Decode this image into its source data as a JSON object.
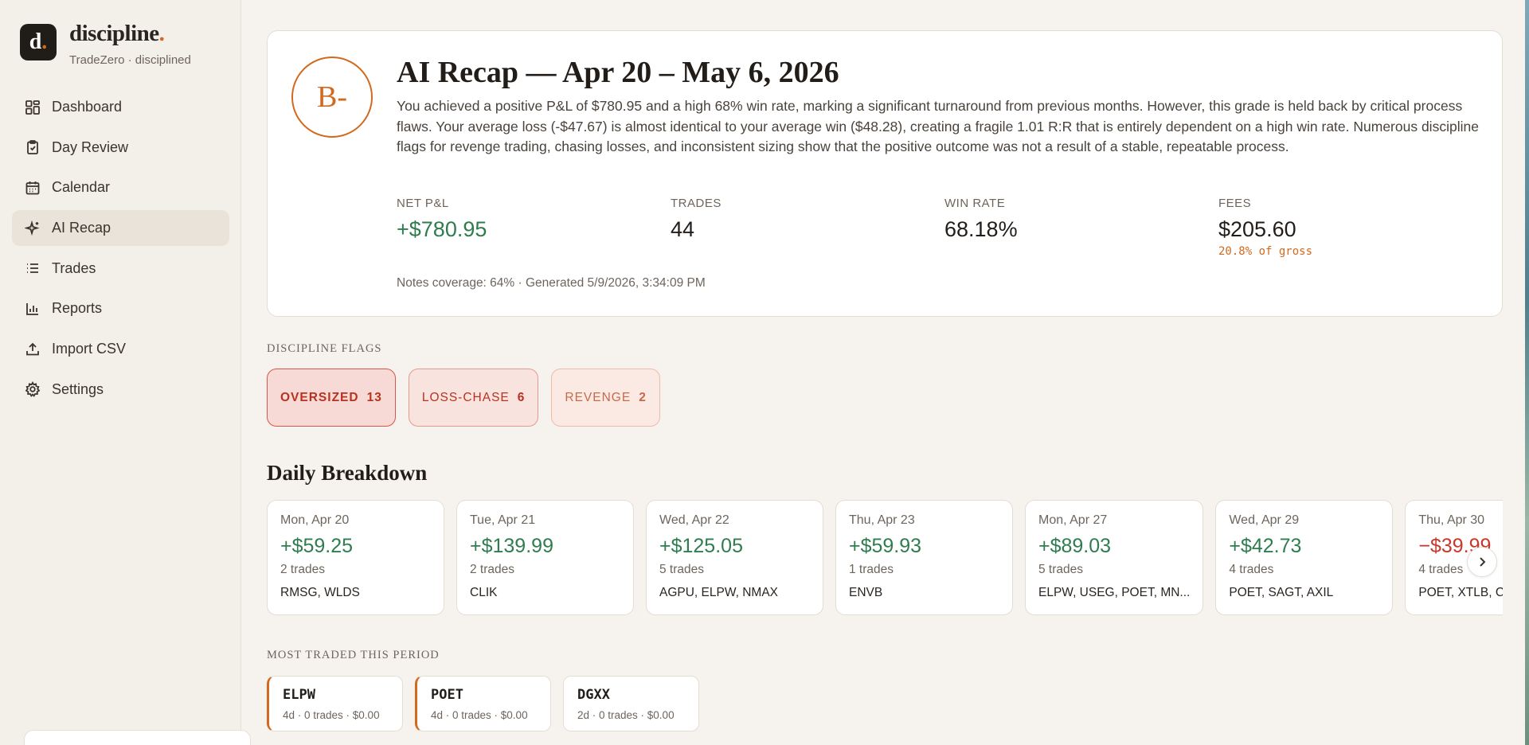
{
  "brand": {
    "logo_letter": "d",
    "logo_dot": ".",
    "name": "discipline",
    "name_dot": ".",
    "subtitle": "TradeZero · disciplined"
  },
  "nav": {
    "items": [
      {
        "label": "Dashboard",
        "icon": "dashboard-icon"
      },
      {
        "label": "Day Review",
        "icon": "clipboard-icon"
      },
      {
        "label": "Calendar",
        "icon": "calendar-icon"
      },
      {
        "label": "AI Recap",
        "icon": "sparkle-icon",
        "active": true
      },
      {
        "label": "Trades",
        "icon": "list-icon"
      },
      {
        "label": "Reports",
        "icon": "bar-chart-icon"
      },
      {
        "label": "Import CSV",
        "icon": "upload-icon"
      },
      {
        "label": "Settings",
        "icon": "gear-icon"
      }
    ]
  },
  "recap": {
    "grade": "B-",
    "title": "AI Recap — Apr 20 – May 6, 2026",
    "body": "You achieved a positive P&L of $780.95 and a high 68% win rate, marking a significant turnaround from previous months. However, this grade is held back by critical process flaws. Your average loss (-$47.67) is almost identical to your average win ($48.28), creating a fragile 1.01 R:R that is entirely dependent on a high win rate. Numerous discipline flags for revenge trading, chasing losses, and inconsistent sizing show that the positive outcome was not a result of a stable, repeatable process.",
    "stats": {
      "net_pnl": {
        "label": "NET P&L",
        "value": "+$780.95"
      },
      "trades": {
        "label": "TRADES",
        "value": "44"
      },
      "win_rate": {
        "label": "WIN RATE",
        "value": "68.18%"
      },
      "fees": {
        "label": "FEES",
        "value": "$205.60",
        "sub": "20.8% of gross"
      }
    },
    "footer": "Notes coverage: 64% · Generated 5/9/2026, 3:34:09 PM"
  },
  "flags": {
    "label": "DISCIPLINE FLAGS",
    "items": [
      {
        "name": "OVERSIZED",
        "count": "13"
      },
      {
        "name": "LOSS-CHASE",
        "count": "6"
      },
      {
        "name": "REVENGE",
        "count": "2"
      }
    ]
  },
  "daily": {
    "title": "Daily Breakdown",
    "days": [
      {
        "date": "Mon, Apr 20",
        "pnl": "+$59.25",
        "trades": "2 trades",
        "tickers": "RMSG, WLDS"
      },
      {
        "date": "Tue, Apr 21",
        "pnl": "+$139.99",
        "trades": "2 trades",
        "tickers": "CLIK"
      },
      {
        "date": "Wed, Apr 22",
        "pnl": "+$125.05",
        "trades": "5 trades",
        "tickers": "AGPU, ELPW, NMAX"
      },
      {
        "date": "Thu, Apr 23",
        "pnl": "+$59.93",
        "trades": "1 trades",
        "tickers": "ENVB"
      },
      {
        "date": "Mon, Apr 27",
        "pnl": "+$89.03",
        "trades": "5 trades",
        "tickers": "ELPW, USEG, POET, MN..."
      },
      {
        "date": "Wed, Apr 29",
        "pnl": "+$42.73",
        "trades": "4 trades",
        "tickers": "POET, SAGT, AXIL"
      },
      {
        "date": "Thu, Apr 30",
        "pnl": "−$39.99",
        "trades": "4 trades",
        "tickers": "POET, XTLB, C",
        "negative": true
      }
    ]
  },
  "most_traded": {
    "label": "MOST TRADED THIS PERIOD",
    "items": [
      {
        "symbol": "ELPW",
        "meta": "4d · 0 trades · $0.00",
        "highlight": true
      },
      {
        "symbol": "POET",
        "meta": "4d · 0 trades · $0.00",
        "highlight": true
      },
      {
        "symbol": "DGXX",
        "meta": "2d · 0 trades · $0.00",
        "highlight": false
      }
    ]
  },
  "colors": {
    "accent": "#d2691e",
    "positive": "#2f7d4f",
    "negative": "#c8372a",
    "background": "#f6f3ee"
  }
}
